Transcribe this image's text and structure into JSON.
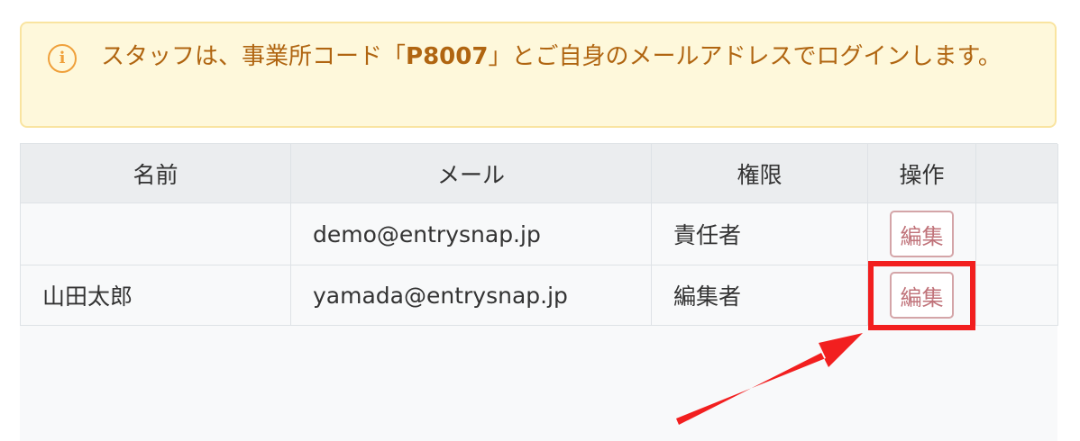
{
  "notice": {
    "text_before": "スタッフは、事業所コード「",
    "code": "P8007",
    "text_after": "」とご自身のメールアドレスでログインします。",
    "icon": "info-icon",
    "icon_glyph": "i",
    "color": "#b06511"
  },
  "table": {
    "headers": {
      "name": "名前",
      "email": "メール",
      "role": "権限",
      "actions": "操作"
    },
    "rows": [
      {
        "name": "",
        "email": "demo@entrysnap.jp",
        "role": "責任者",
        "edit_label": "編集"
      },
      {
        "name": "山田太郎",
        "email": "yamada@entrysnap.jp",
        "role": "編集者",
        "edit_label": "編集"
      }
    ]
  },
  "annotation": {
    "highlight_color": "#f21f1f"
  }
}
